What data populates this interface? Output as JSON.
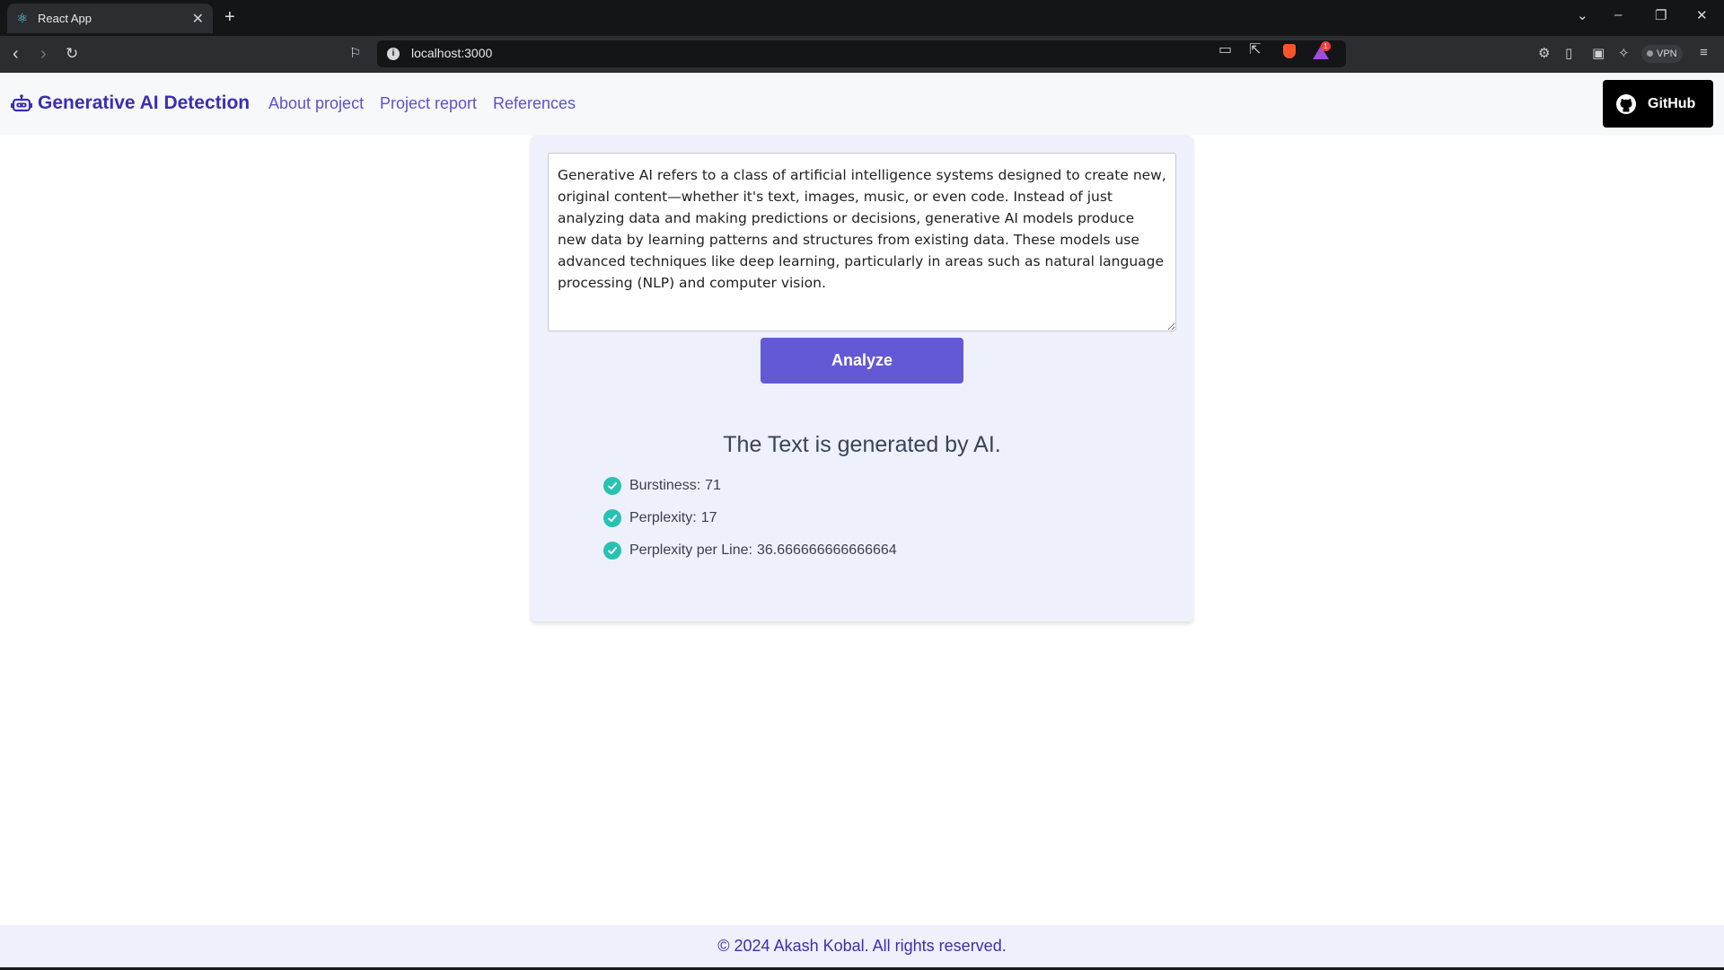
{
  "browser": {
    "tab_title": "React App",
    "url": "localhost:3000",
    "vpn_label": "VPN",
    "rewards_badge": "1"
  },
  "header": {
    "brand": "Generative AI Detection",
    "nav": [
      "About project",
      "Project report",
      "References"
    ],
    "github_label": "GitHub"
  },
  "analyzer": {
    "input_text": "Generative AI refers to a class of artificial intelligence systems designed to create new, original content—whether it's text, images, music, or even code. Instead of just analyzing data and making predictions or decisions, generative AI models produce new data by learning patterns and structures from existing data. These models use advanced techniques like deep learning, particularly in areas such as natural language processing (NLP) and computer vision.",
    "analyze_label": "Analyze",
    "result_title": "The Text is generated by AI.",
    "metrics": [
      {
        "label": "Burstiness:",
        "value": "71"
      },
      {
        "label": "Perplexity:",
        "value": "17"
      },
      {
        "label": "Perplexity per Line:",
        "value": "36.666666666666664"
      }
    ]
  },
  "footer": {
    "text": "© 2024 Akash Kobal. All rights reserved."
  },
  "colors": {
    "brand": "#3a2fb0",
    "accent": "#6459d4",
    "check": "#28c2b2",
    "card_bg": "#eef0fb"
  },
  "icons": {
    "tab": "react-icon",
    "brand": "robot-icon",
    "github": "github-icon",
    "metric": "check-circle-icon"
  }
}
